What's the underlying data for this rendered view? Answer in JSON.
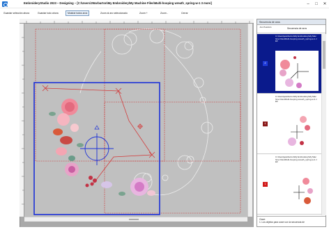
{
  "window": {
    "title": "EmbroideryStudio 2023 – Designing – [C:\\Users\\JWarburton\\My Embroidery\\My Machine Files\\Multi-hooping wreath_spring-w-1    3 more]"
  },
  "toolbar": {
    "items": [
      {
        "label": "Guardar selección ahora"
      },
      {
        "label": "Guardar todo ahora"
      },
      {
        "label": "Mostrar todos aros"
      },
      {
        "label": "Zoom al aro seleccionado"
      },
      {
        "label": "Zoom +"
      },
      {
        "label": "Zoom -"
      },
      {
        "label": "Cerrar"
      }
    ]
  },
  "panel": {
    "title": "Secuencia de aros",
    "col_position": "Aro Posición",
    "col_sequence": "Secuencia de aros",
    "items": [
      {
        "position": "2",
        "path": "C:\\Users\\jwarburton\\My Embroidery\\My Machine Files\\Multi-hooping wreath_spring-w-1.JEF",
        "badge_color": "#1f3bd9",
        "selected": true
      },
      {
        "position": "4",
        "path": "C:\\Users\\jwarburton\\My Embroidery\\My Machine Files\\Multi-hooping wreath_spring-w-3.JEF",
        "badge_color": "#8b1a1a",
        "selected": false
      },
      {
        "position": "1",
        "path": "C:\\Users\\jwarburton\\My Embroidery\\My Machine Files\\Multi-hooping wreath_spring-w-2.JEF",
        "badge_color": "#d11a1a",
        "selected": false
      }
    ],
    "footer_label": "Clave:",
    "footer_text": "1. Los objetos para coser con la secuencia de"
  },
  "colors": {
    "hoop_active": "#1a2fd8",
    "hoop_inactive": "#cc3333",
    "selection_bg": "#0a1a8c",
    "canvas": "#c0c0c0"
  }
}
